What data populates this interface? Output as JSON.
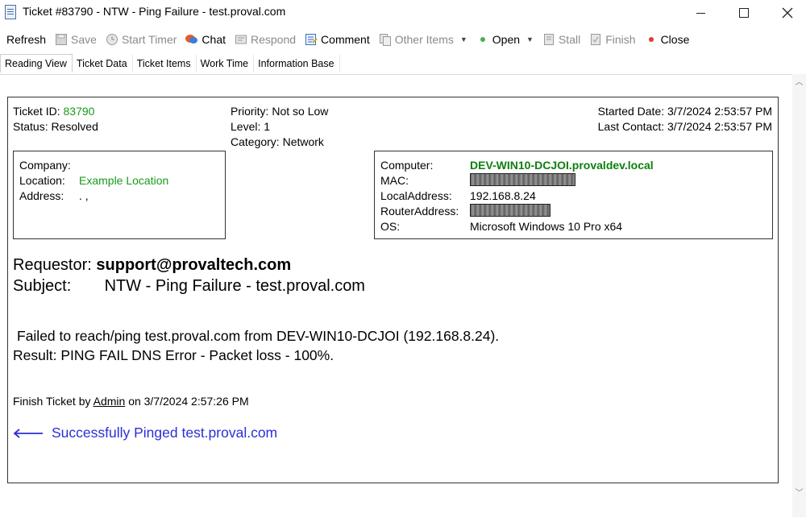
{
  "window": {
    "title": "Ticket #83790 - NTW - Ping Failure - test.proval.com"
  },
  "toolbar": {
    "refresh": "Refresh",
    "save": "Save",
    "start_timer": "Start Timer",
    "chat": "Chat",
    "respond": "Respond",
    "comment": "Comment",
    "other_items": "Other Items",
    "open": "Open",
    "stall": "Stall",
    "finish": "Finish",
    "close": "Close"
  },
  "tabs": [
    "Reading View",
    "Ticket Data",
    "Ticket Items",
    "Work Time",
    "Information Base"
  ],
  "ticket": {
    "id_label": "Ticket ID:",
    "id_value": "83790",
    "status_label": "Status:",
    "status_value": "Resolved",
    "priority": "Priority: Not so Low",
    "level": "Level: 1",
    "category": "Category: Network",
    "started": "Started Date: 3/7/2024 2:53:57 PM",
    "last_contact": "Last Contact: 3/7/2024 2:53:57 PM"
  },
  "company_box": {
    "company_label": "Company:",
    "location_label": "Location:",
    "location_value": "Example Location",
    "address_label": "Address:",
    "address_value": ". ,"
  },
  "computer_box": {
    "computer_label": "Computer:",
    "computer_value": "DEV-WIN10-DCJOI.provaldev.local",
    "mac_label": "MAC:",
    "local_label": "LocalAddress:",
    "local_value": "192.168.8.24",
    "router_label": "RouterAddress:",
    "os_label": "OS:",
    "os_value": "Microsoft Windows 10 Pro x64"
  },
  "request": {
    "requestor_label": "Requestor:",
    "requestor_value": "support@provaltech.com",
    "subject_label": "Subject:",
    "subject_value": "NTW - Ping Failure - test.proval.com"
  },
  "message": {
    "line1": "Failed to reach/ping test.proval.com from DEV-WIN10-DCJOI (192.168.8.24).",
    "line2": "Result: PING FAIL DNS Error - Packet loss - 100%."
  },
  "finish_note": {
    "prefix": "Finish Ticket by",
    "user": "Admin",
    "suffix": "on 3/7/2024 2:57:26 PM"
  },
  "success_note": "Successfully Pinged test.proval.com",
  "colors": {
    "green": "#1a9a1a",
    "blue_link": "#2a2fd6"
  }
}
